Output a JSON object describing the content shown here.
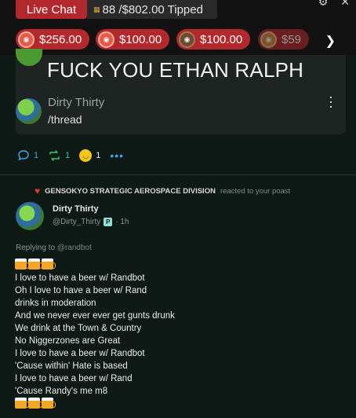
{
  "topbar": {
    "live_chat_label": "Live Chat",
    "tipped_label": "88 /$802.00 Tipped",
    "tipped_icon": "grid-icon",
    "icons": [
      "gear-icon",
      "close-icon"
    ]
  },
  "tips": [
    {
      "amount": "$256.00"
    },
    {
      "amount": "$100.00"
    },
    {
      "amount": "$100.00"
    },
    {
      "amount": "$59"
    }
  ],
  "card": {
    "headline": "FUCK YOU ETHAN RALPH",
    "quoted_name": "Dirty Thirty",
    "quoted_text": "/thread"
  },
  "actions": {
    "replies": "1",
    "reposts": "1",
    "reactions": "1"
  },
  "notification": {
    "actor": "GENSOKYO STRATEGIC AEROSPACE DIVISION",
    "action": "reacted to your poast"
  },
  "post": {
    "author_name": "Dirty Thirty",
    "handle": "@Dirty_Thirty",
    "badge": "P",
    "time": "· 1h",
    "replying_label": "Replying to",
    "replying_to": "@randbot",
    "lines": [
      "I love to have a beer w/ Randbot",
      "Oh I love to have a beer w/ Rand",
      "drinks in moderation",
      "And we never ever ever get gunts drunk",
      "We drink at the Town & Country",
      "No Niggerzones are Great",
      "I love to have a beer w/ Randbot",
      "'Cause within' Hate is based",
      "I love to have a beer w/ Rand",
      "'Cause Randy's me m8"
    ]
  },
  "colors": {
    "live_red": "#b3282d",
    "background": "#0f1a17",
    "reply_blue": "#3fa6e8",
    "repost_green": "#2ecc71",
    "heart_red": "#e0353b"
  }
}
